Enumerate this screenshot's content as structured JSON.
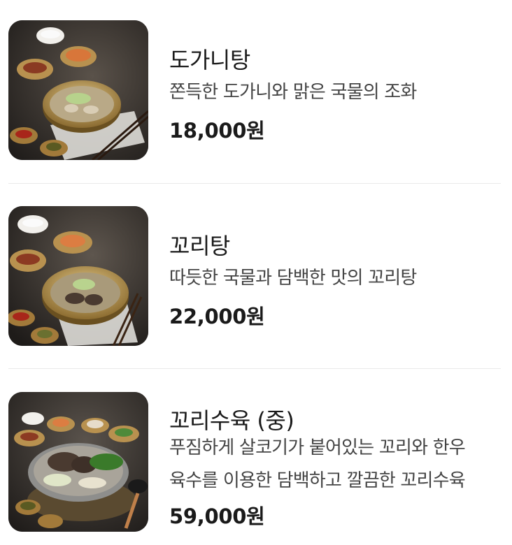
{
  "menu": {
    "items": [
      {
        "name": "도가니탕",
        "description": [
          "쫀득한 도가니와 맑은 국물의 조화"
        ],
        "price": "18,000원",
        "image": "dogani-tang-photo"
      },
      {
        "name": "꼬리탕",
        "description": [
          "따듯한 국물과 담백한 맛의 꼬리탕"
        ],
        "price": "22,000원",
        "image": "kkori-tang-photo"
      },
      {
        "name": "꼬리수육 (중)",
        "description": [
          "푸짐하게 살코기가 붙어있는 꼬리와 한우",
          "육수를 이용한 담백하고 깔끔한 꼬리수육"
        ],
        "price": "59,000원",
        "image": "kkori-suyuk-photo"
      }
    ]
  }
}
